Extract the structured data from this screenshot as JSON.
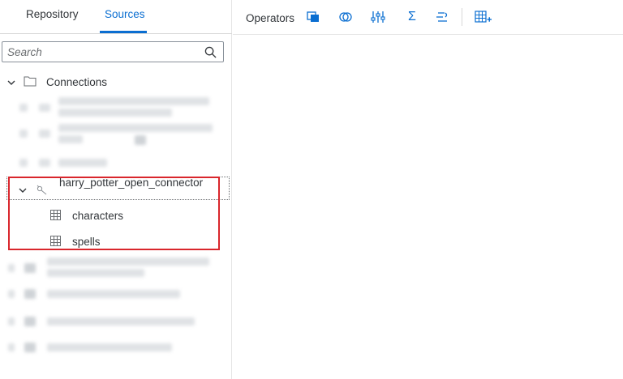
{
  "tabs": [
    {
      "label": "Repository"
    },
    {
      "label": "Sources"
    }
  ],
  "search": {
    "placeholder": "Search"
  },
  "tree": {
    "root_label": "Connections",
    "open_connection_label": "harry_potter_open_connector",
    "tables": [
      {
        "label": "characters"
      },
      {
        "label": "spells"
      }
    ]
  },
  "toolbar": {
    "label": "Operators",
    "sum_symbol": "Σ"
  },
  "colors": {
    "accent": "#0a6ed1",
    "highlight": "#d9262c",
    "text": "#32363a",
    "icon": "#0a6ed1"
  },
  "icons": [
    "search-icon",
    "folder-icon",
    "connection-icon",
    "table-icon",
    "chevron-down-icon",
    "chevron-right-icon",
    "projection-icon",
    "join-icon",
    "aggregation-filter-icon",
    "sum-icon",
    "script-icon",
    "add-table-icon"
  ]
}
